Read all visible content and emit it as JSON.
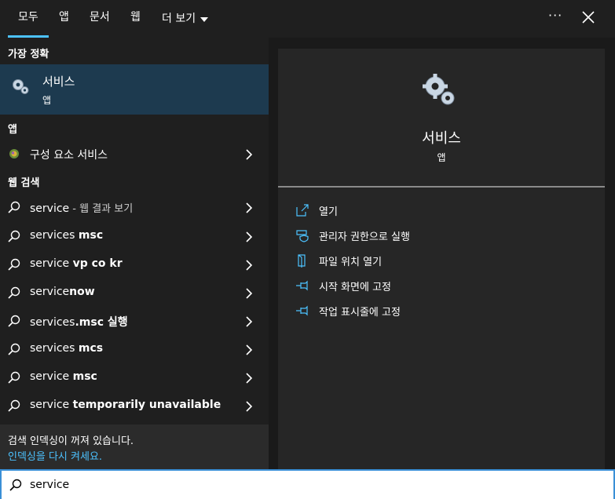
{
  "tabs": [
    {
      "label": "모두",
      "active": true
    },
    {
      "label": "앱"
    },
    {
      "label": "문서"
    },
    {
      "label": "웹"
    },
    {
      "label": "더 보기"
    }
  ],
  "header_icons": {
    "more": "more-horizontal-icon",
    "close": "close-icon",
    "more_glyph": "···"
  },
  "best_match": {
    "section_label": "가장 정확",
    "title": "서비스",
    "subtitle": "앱",
    "icon": "gear-icon"
  },
  "apps_section": {
    "label": "앱",
    "items": [
      {
        "label": "구성 요소 서비스",
        "icon": "component-services-icon"
      }
    ]
  },
  "web_section": {
    "label": "웹 검색",
    "items": [
      {
        "plain": "service",
        "bold": "",
        "suffix": " - 웹 결과 보기"
      },
      {
        "plain": "services ",
        "bold": "msc",
        "suffix": ""
      },
      {
        "plain": "service ",
        "bold": "vp co kr",
        "suffix": ""
      },
      {
        "plain": "service",
        "bold": "now",
        "suffix": ""
      },
      {
        "plain": "services",
        "bold": ".msc 실행",
        "suffix": ""
      },
      {
        "plain": "services ",
        "bold": "mcs",
        "suffix": ""
      },
      {
        "plain": "service ",
        "bold": "msc",
        "suffix": ""
      },
      {
        "plain": "service ",
        "bold": "temporarily unavailable",
        "suffix": ""
      }
    ]
  },
  "notice": {
    "line1": "검색 인덱싱이 꺼져 있습니다.",
    "link": "인덱싱을 다시 켜세요."
  },
  "detail": {
    "title": "서비스",
    "subtitle": "앱",
    "icon": "gear-icon",
    "actions": [
      {
        "label": "열기",
        "icon": "open-icon"
      },
      {
        "label": "관리자 권한으로 실행",
        "icon": "shield-icon"
      },
      {
        "label": "파일 위치 열기",
        "icon": "file-location-icon"
      },
      {
        "label": "시작 화면에 고정",
        "icon": "pin-icon"
      },
      {
        "label": "작업 표시줄에 고정",
        "icon": "pin-icon"
      }
    ]
  },
  "search": {
    "value": "service",
    "icon": "search-icon"
  },
  "colors": {
    "accent": "#4cc2ff",
    "selected": "#1d3a4f",
    "background": "#1f1f1f",
    "panel": "#262626"
  }
}
